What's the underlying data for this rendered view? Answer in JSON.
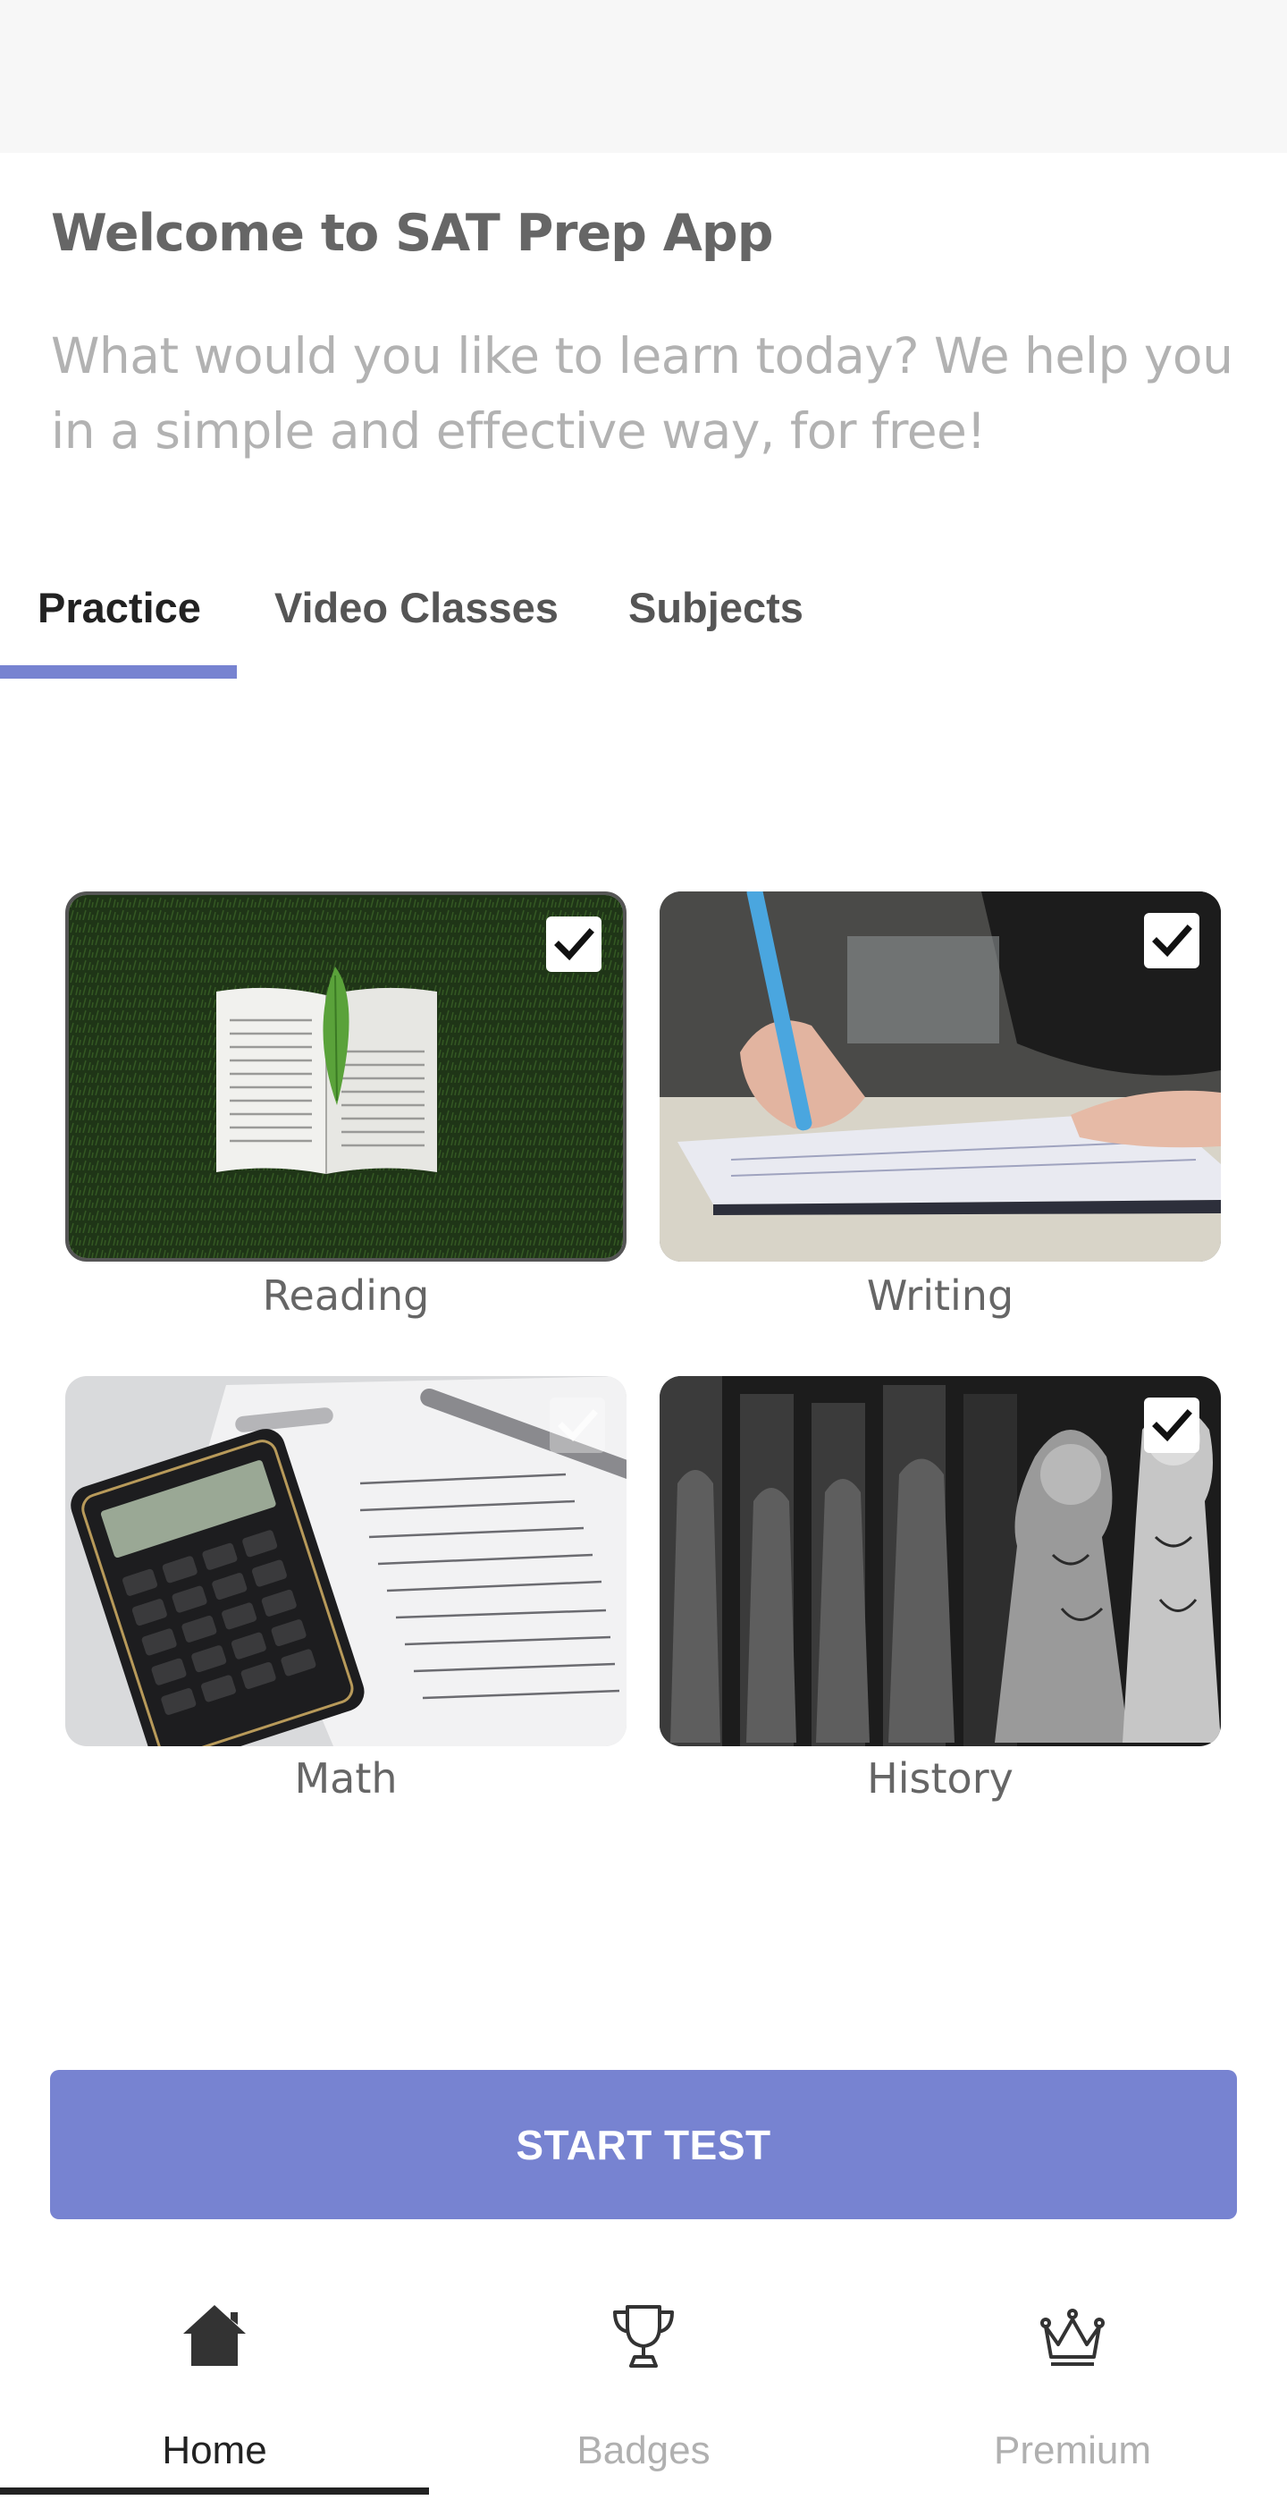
{
  "header": {
    "title": "Welcome to SAT Prep App",
    "subtitle": "What would you like to learn today? We help you in a simple and effective way, for free!"
  },
  "tabs": [
    {
      "label": "Practice",
      "active": true
    },
    {
      "label": "Video Classes",
      "active": false
    },
    {
      "label": "Subjects",
      "active": false
    }
  ],
  "subjects": [
    {
      "label": "Reading",
      "checked": true,
      "image": "open-book-on-grass-photo"
    },
    {
      "label": "Writing",
      "checked": true,
      "image": "hand-writing-notebook-photo"
    },
    {
      "label": "Math",
      "checked": false,
      "image": "calculator-and-papers-photo"
    },
    {
      "label": "History",
      "checked": true,
      "image": "statues-photo"
    }
  ],
  "actions": {
    "start_label": "START TEST"
  },
  "bottom_nav": [
    {
      "label": "Home",
      "icon": "home-icon",
      "active": true
    },
    {
      "label": "Badges",
      "icon": "trophy-icon",
      "active": false
    },
    {
      "label": "Premium",
      "icon": "crown-icon",
      "active": false
    }
  ],
  "colors": {
    "accent": "#7783d1",
    "title_text": "#666666",
    "subtitle_text": "#b2b2b2",
    "inactive_nav": "#b0b0b0"
  }
}
